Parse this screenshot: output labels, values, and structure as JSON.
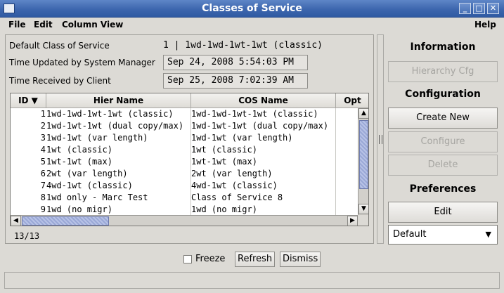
{
  "window": {
    "title": "Classes of Service",
    "controls": [
      "minimize",
      "maximize",
      "close"
    ]
  },
  "menu": {
    "file": "File",
    "edit": "Edit",
    "column_view": "Column View",
    "help": "Help"
  },
  "info": {
    "default_cos_label": "Default Class of Service",
    "default_cos_value": "1 | 1wd-1wd-1wt-1wt (classic)",
    "time_updated_label": "Time Updated by System Manager",
    "time_updated_value": "Sep 24, 2008 5:54:03 PM",
    "time_received_label": "Time Received by Client",
    "time_received_value": "Sep 25, 2008 7:02:39 AM"
  },
  "table": {
    "columns": [
      "ID ▼",
      "Hier Name",
      "COS Name",
      "Opt"
    ],
    "rows": [
      {
        "id": "1",
        "hier": "1wd-1wd-1wt-1wt (classic)",
        "cos": "1wd-1wd-1wt-1wt (classic)"
      },
      {
        "id": "2",
        "hier": "1wd-1wt-1wt (dual copy/max)",
        "cos": "1wd-1wt-1wt (dual copy/max)"
      },
      {
        "id": "3",
        "hier": "1wd-1wt (var length)",
        "cos": "1wd-1wt (var length)"
      },
      {
        "id": "4",
        "hier": "1wt (classic)",
        "cos": "1wt (classic)"
      },
      {
        "id": "5",
        "hier": "1wt-1wt (max)",
        "cos": "1wt-1wt (max)"
      },
      {
        "id": "6",
        "hier": "2wt (var length)",
        "cos": "2wt (var length)"
      },
      {
        "id": "7",
        "hier": "4wd-1wt (classic)",
        "cos": "4wd-1wt (classic)"
      },
      {
        "id": "8",
        "hier": "1wd only - Marc Test",
        "cos": "Class of Service 8"
      },
      {
        "id": "9",
        "hier": "1wd (no migr)",
        "cos": "1wd (no migr)"
      }
    ],
    "count": "13/13"
  },
  "right_panel": {
    "information": "Information",
    "hierarchy_cfg": "Hierarchy Cfg",
    "configuration": "Configuration",
    "create_new": "Create New",
    "configure": "Configure",
    "delete": "Delete",
    "preferences": "Preferences",
    "edit": "Edit",
    "preference_value": "Default"
  },
  "bottom": {
    "freeze": "Freeze",
    "refresh": "Refresh",
    "dismiss": "Dismiss"
  },
  "colors": {
    "titlebar": "#3d66ae",
    "background": "#dcdad5",
    "scroll_thumb": "#9aa8d6"
  }
}
